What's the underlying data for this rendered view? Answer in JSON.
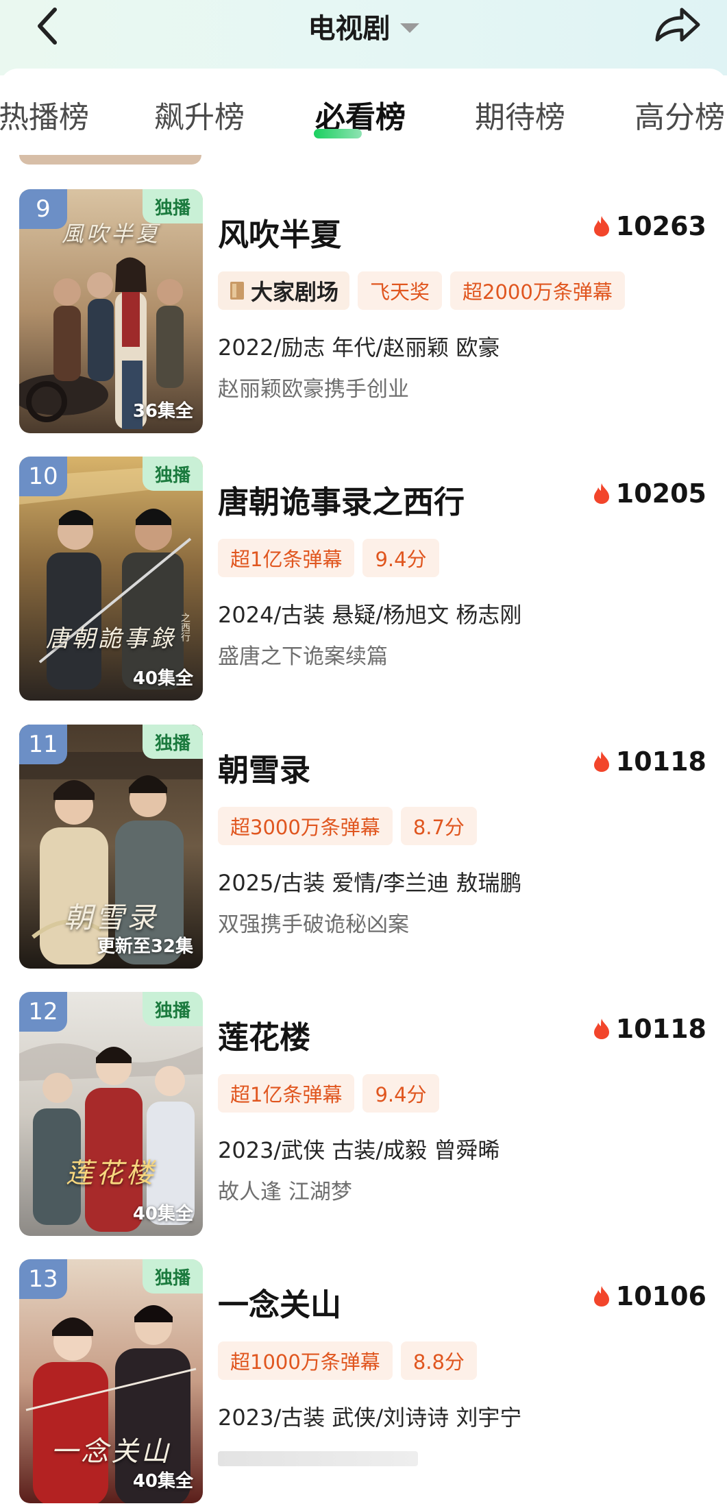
{
  "header": {
    "title": "电视剧",
    "back_icon": "chevron-left-icon",
    "share_icon": "share-arrow-icon",
    "dropdown_icon": "caret-down-icon"
  },
  "tabs": [
    {
      "label": "热播榜",
      "active": false
    },
    {
      "label": "飙升榜",
      "active": false
    },
    {
      "label": "必看榜",
      "active": true
    },
    {
      "label": "期待榜",
      "active": false
    },
    {
      "label": "高分榜",
      "active": false
    }
  ],
  "colors": {
    "accent_green": "#1ad05f",
    "tag_text": "#e0561f",
    "tag_bg": "#fdf0e8",
    "heat_flame": "#f2452b",
    "exclusive_bg": "#c9f0d6",
    "rank_badge_bg": "#6c8fc6"
  },
  "items": [
    {
      "rank": "9",
      "exclusive": "独播",
      "episodes": "36集全",
      "poster_title": "風吹半夏",
      "title": "风吹半夏",
      "heat": "10263",
      "brand_tag": "大家剧场",
      "tags": [
        "飞天奖",
        "超2000万条弹幕"
      ],
      "meta": "2022/励志 年代/赵丽颖 欧豪",
      "desc": "赵丽颖欧豪携手创业"
    },
    {
      "rank": "10",
      "exclusive": "独播",
      "episodes": "40集全",
      "poster_title": "唐朝詭事錄",
      "poster_subtag": "之西行",
      "title": "唐朝诡事录之西行",
      "heat": "10205",
      "tags": [
        "超1亿条弹幕",
        "9.4分"
      ],
      "meta": "2024/古装 悬疑/杨旭文 杨志刚",
      "desc": "盛唐之下诡案续篇"
    },
    {
      "rank": "11",
      "exclusive": "独播",
      "episodes": "更新至32集",
      "poster_title": "朝雪录",
      "title": "朝雪录",
      "heat": "10118",
      "tags": [
        "超3000万条弹幕",
        "8.7分"
      ],
      "meta": "2025/古装 爱情/李兰迪 敖瑞鹏",
      "desc": "双强携手破诡秘凶案"
    },
    {
      "rank": "12",
      "exclusive": "独播",
      "episodes": "40集全",
      "poster_title": "莲花楼",
      "title": "莲花楼",
      "heat": "10118",
      "tags": [
        "超1亿条弹幕",
        "9.4分"
      ],
      "meta": "2023/武侠 古装/成毅 曾舜晞",
      "desc": "故人逢 江湖梦"
    },
    {
      "rank": "13",
      "exclusive": "独播",
      "episodes": "40集全",
      "poster_title": "一念关山",
      "title": "一念关山",
      "heat": "10106",
      "tags": [
        "超1000万条弹幕",
        "8.8分"
      ],
      "meta": "2023/古装 武侠/刘诗诗 刘宇宁"
    }
  ]
}
